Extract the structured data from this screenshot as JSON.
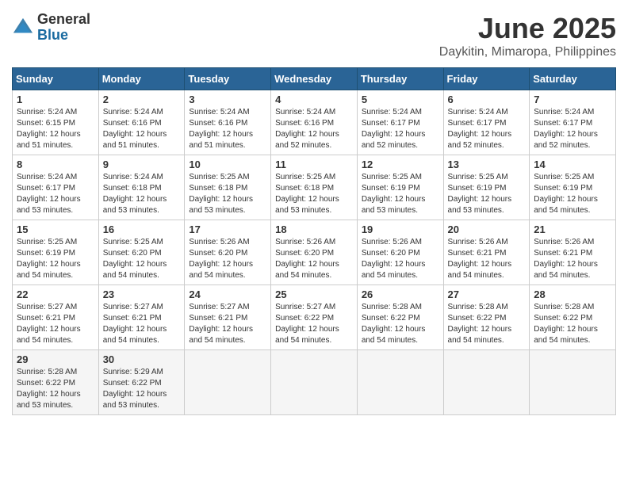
{
  "header": {
    "logo_general": "General",
    "logo_blue": "Blue",
    "month_year": "June 2025",
    "location": "Daykitin, Mimaropa, Philippines"
  },
  "calendar": {
    "headers": [
      "Sunday",
      "Monday",
      "Tuesday",
      "Wednesday",
      "Thursday",
      "Friday",
      "Saturday"
    ],
    "weeks": [
      [
        {
          "day": "",
          "info": ""
        },
        {
          "day": "2",
          "info": "Sunrise: 5:24 AM\nSunset: 6:16 PM\nDaylight: 12 hours\nand 51 minutes."
        },
        {
          "day": "3",
          "info": "Sunrise: 5:24 AM\nSunset: 6:16 PM\nDaylight: 12 hours\nand 51 minutes."
        },
        {
          "day": "4",
          "info": "Sunrise: 5:24 AM\nSunset: 6:16 PM\nDaylight: 12 hours\nand 52 minutes."
        },
        {
          "day": "5",
          "info": "Sunrise: 5:24 AM\nSunset: 6:17 PM\nDaylight: 12 hours\nand 52 minutes."
        },
        {
          "day": "6",
          "info": "Sunrise: 5:24 AM\nSunset: 6:17 PM\nDaylight: 12 hours\nand 52 minutes."
        },
        {
          "day": "7",
          "info": "Sunrise: 5:24 AM\nSunset: 6:17 PM\nDaylight: 12 hours\nand 52 minutes."
        }
      ],
      [
        {
          "day": "8",
          "info": "Sunrise: 5:24 AM\nSunset: 6:17 PM\nDaylight: 12 hours\nand 53 minutes."
        },
        {
          "day": "9",
          "info": "Sunrise: 5:24 AM\nSunset: 6:18 PM\nDaylight: 12 hours\nand 53 minutes."
        },
        {
          "day": "10",
          "info": "Sunrise: 5:25 AM\nSunset: 6:18 PM\nDaylight: 12 hours\nand 53 minutes."
        },
        {
          "day": "11",
          "info": "Sunrise: 5:25 AM\nSunset: 6:18 PM\nDaylight: 12 hours\nand 53 minutes."
        },
        {
          "day": "12",
          "info": "Sunrise: 5:25 AM\nSunset: 6:19 PM\nDaylight: 12 hours\nand 53 minutes."
        },
        {
          "day": "13",
          "info": "Sunrise: 5:25 AM\nSunset: 6:19 PM\nDaylight: 12 hours\nand 53 minutes."
        },
        {
          "day": "14",
          "info": "Sunrise: 5:25 AM\nSunset: 6:19 PM\nDaylight: 12 hours\nand 54 minutes."
        }
      ],
      [
        {
          "day": "15",
          "info": "Sunrise: 5:25 AM\nSunset: 6:19 PM\nDaylight: 12 hours\nand 54 minutes."
        },
        {
          "day": "16",
          "info": "Sunrise: 5:25 AM\nSunset: 6:20 PM\nDaylight: 12 hours\nand 54 minutes."
        },
        {
          "day": "17",
          "info": "Sunrise: 5:26 AM\nSunset: 6:20 PM\nDaylight: 12 hours\nand 54 minutes."
        },
        {
          "day": "18",
          "info": "Sunrise: 5:26 AM\nSunset: 6:20 PM\nDaylight: 12 hours\nand 54 minutes."
        },
        {
          "day": "19",
          "info": "Sunrise: 5:26 AM\nSunset: 6:20 PM\nDaylight: 12 hours\nand 54 minutes."
        },
        {
          "day": "20",
          "info": "Sunrise: 5:26 AM\nSunset: 6:21 PM\nDaylight: 12 hours\nand 54 minutes."
        },
        {
          "day": "21",
          "info": "Sunrise: 5:26 AM\nSunset: 6:21 PM\nDaylight: 12 hours\nand 54 minutes."
        }
      ],
      [
        {
          "day": "22",
          "info": "Sunrise: 5:27 AM\nSunset: 6:21 PM\nDaylight: 12 hours\nand 54 minutes."
        },
        {
          "day": "23",
          "info": "Sunrise: 5:27 AM\nSunset: 6:21 PM\nDaylight: 12 hours\nand 54 minutes."
        },
        {
          "day": "24",
          "info": "Sunrise: 5:27 AM\nSunset: 6:21 PM\nDaylight: 12 hours\nand 54 minutes."
        },
        {
          "day": "25",
          "info": "Sunrise: 5:27 AM\nSunset: 6:22 PM\nDaylight: 12 hours\nand 54 minutes."
        },
        {
          "day": "26",
          "info": "Sunrise: 5:28 AM\nSunset: 6:22 PM\nDaylight: 12 hours\nand 54 minutes."
        },
        {
          "day": "27",
          "info": "Sunrise: 5:28 AM\nSunset: 6:22 PM\nDaylight: 12 hours\nand 54 minutes."
        },
        {
          "day": "28",
          "info": "Sunrise: 5:28 AM\nSunset: 6:22 PM\nDaylight: 12 hours\nand 54 minutes."
        }
      ],
      [
        {
          "day": "29",
          "info": "Sunrise: 5:28 AM\nSunset: 6:22 PM\nDaylight: 12 hours\nand 53 minutes."
        },
        {
          "day": "30",
          "info": "Sunrise: 5:29 AM\nSunset: 6:22 PM\nDaylight: 12 hours\nand 53 minutes."
        },
        {
          "day": "",
          "info": ""
        },
        {
          "day": "",
          "info": ""
        },
        {
          "day": "",
          "info": ""
        },
        {
          "day": "",
          "info": ""
        },
        {
          "day": "",
          "info": ""
        }
      ]
    ],
    "first_week_sunday": {
      "day": "1",
      "info": "Sunrise: 5:24 AM\nSunset: 6:15 PM\nDaylight: 12 hours\nand 51 minutes."
    }
  }
}
